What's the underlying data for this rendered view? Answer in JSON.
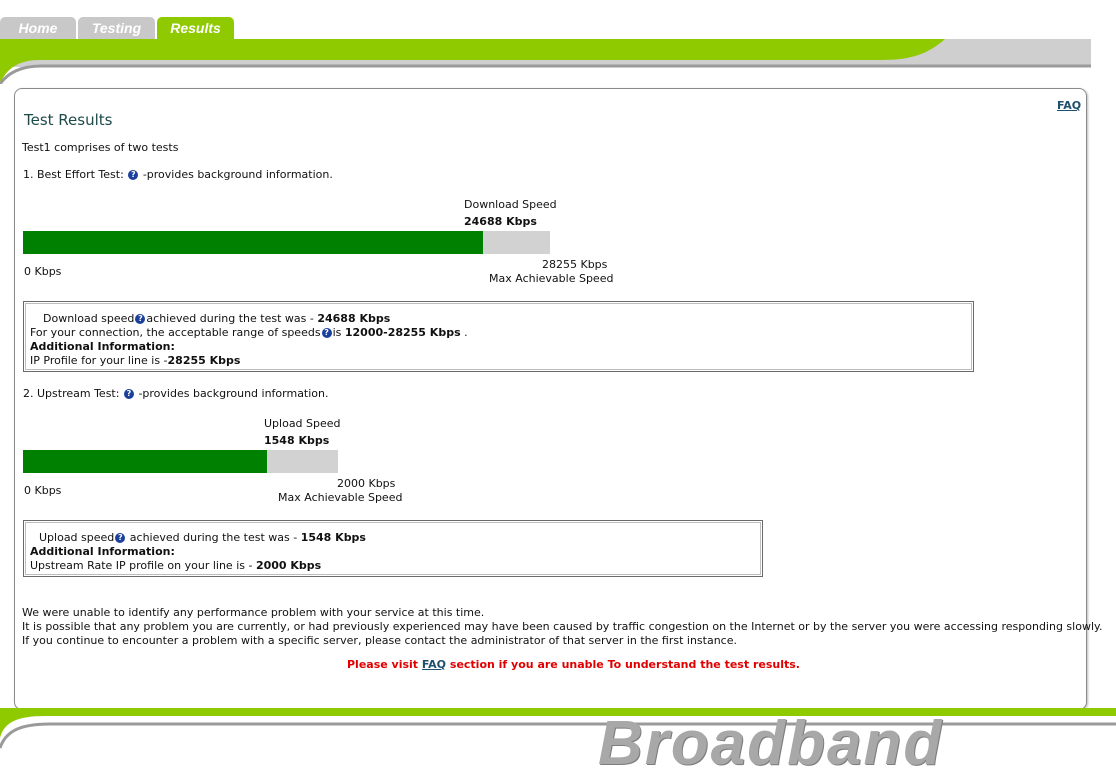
{
  "tabs": [
    {
      "label": "Home"
    },
    {
      "label": "Testing"
    },
    {
      "label": "Results"
    }
  ],
  "faq_link": "FAQ",
  "page_title": "Test Results",
  "intro": "Test1 comprises of two tests",
  "test1": {
    "heading_prefix": "1. Best Effort Test:",
    "heading_suffix": "-provides background information.",
    "bar_title": "Download Speed",
    "bar_value": "24688 Kbps",
    "min_label": "0 Kbps",
    "max_label": "28255 Kbps",
    "max_caption": "Max Achievable Speed",
    "fill_fraction": 0.8737,
    "info": {
      "l1_a": "Download speed",
      "l1_b": "achieved during the test was -",
      "l1_c": "24688 Kbps",
      "l2_a": "For your connection, the acceptable range of speeds",
      "l2_b": "is",
      "l2_c": "12000-28255 Kbps",
      "l2_d": ".",
      "l3": "Additional Information:",
      "l4_a": "IP Profile for your line is -",
      "l4_b": "28255 Kbps"
    }
  },
  "test2": {
    "heading_prefix": "2. Upstream Test:",
    "heading_suffix": "-provides background information.",
    "bar_title": "Upload Speed",
    "bar_value": "1548 Kbps",
    "min_label": "0 Kbps",
    "max_label": "2000 Kbps",
    "max_caption": "Max Achievable Speed",
    "fill_fraction": 0.774,
    "info": {
      "l1_a": "Upload speed",
      "l1_b": "achieved during the test was -",
      "l1_c": "1548 Kbps",
      "l3": "Additional Information:",
      "l4_a": "Upstream Rate IP profile on your line is -",
      "l4_b": "2000 Kbps"
    }
  },
  "summary": {
    "l1": "We were unable to identify any performance problem with your service at this time.",
    "l2": "It is possible that any problem you are currently, or had previously experienced may have been caused by traffic congestion on the Internet or by the server you were accessing responding slowly.",
    "l3": "If you continue to encounter a problem with a specific server, please contact the administrator of that server in the first instance."
  },
  "notice": {
    "before": "Please visit",
    "link": "FAQ",
    "after": "section if you are unable To understand the test results."
  },
  "brand": "Broadband",
  "colors": {
    "accent_green": "#8fca00",
    "bar_fill": "#008000",
    "bar_track": "#d2d2d2",
    "notice_red": "#e00000"
  }
}
